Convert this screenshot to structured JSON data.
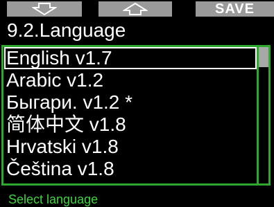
{
  "softkeys": {
    "left_icon": "arrow-down-icon",
    "middle_icon": "arrow-up-icon",
    "right_label": "SAVE"
  },
  "title": "9.2.Language",
  "languages": [
    "English v1.7",
    "Arabic v1.2",
    "Быгари. v1.2 *",
    "简体中文 v1.8",
    "Hrvatski v1.8",
    "Čeština v1.8"
  ],
  "selected_index": 0,
  "status": "Select language",
  "colors": {
    "background": "#000000",
    "softkey": "#9a9a9a",
    "frame": "#2ea82e",
    "status_text": "#3ed43e",
    "scroll_thumb": "#a8a8a8"
  }
}
